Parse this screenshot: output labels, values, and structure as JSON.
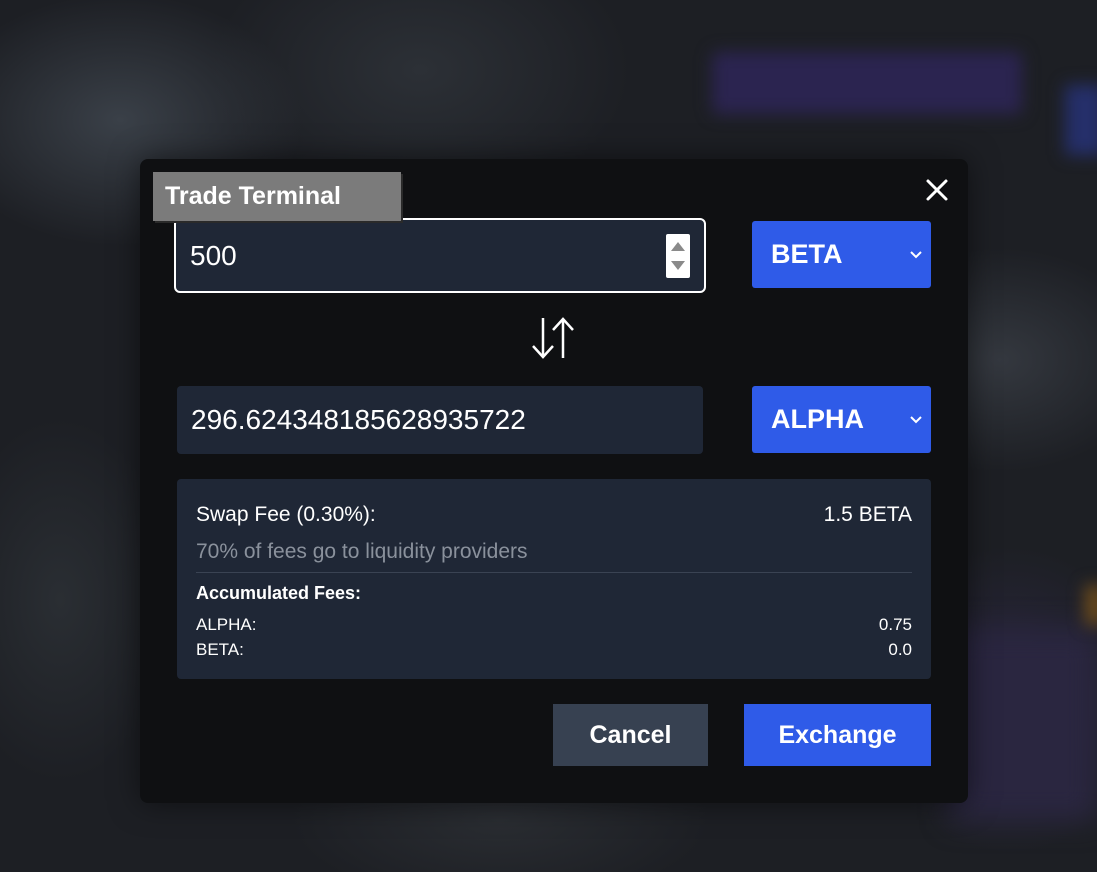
{
  "modal": {
    "title": "Trade Terminal",
    "close_icon": "close-icon"
  },
  "input": {
    "amount_in": "500",
    "amount_out": "296.624348185628935722",
    "spinner_icon": "spinner-arrows-icon"
  },
  "tokens": {
    "from": "BETA",
    "to": "ALPHA",
    "from_options": [
      "BETA"
    ],
    "to_options": [
      "ALPHA"
    ],
    "dropdown_icon": "chevron-down-icon"
  },
  "swap": {
    "icon": "swap-arrows-icon"
  },
  "fees": {
    "swap_fee_label": "Swap Fee (0.30%):",
    "swap_fee_value": "1.5 BETA",
    "note": "70% of fees go to liquidity providers",
    "accumulated_title": "Accumulated Fees:",
    "accumulated": [
      {
        "token": "ALPHA:",
        "value": "0.75"
      },
      {
        "token": "BETA:",
        "value": "0.0"
      }
    ]
  },
  "actions": {
    "cancel_label": "Cancel",
    "exchange_label": "Exchange"
  },
  "colors": {
    "accent": "#2f5be8",
    "panel": "#1f2736",
    "modal_bg": "#0f1012",
    "cancel_bg": "#374151"
  }
}
